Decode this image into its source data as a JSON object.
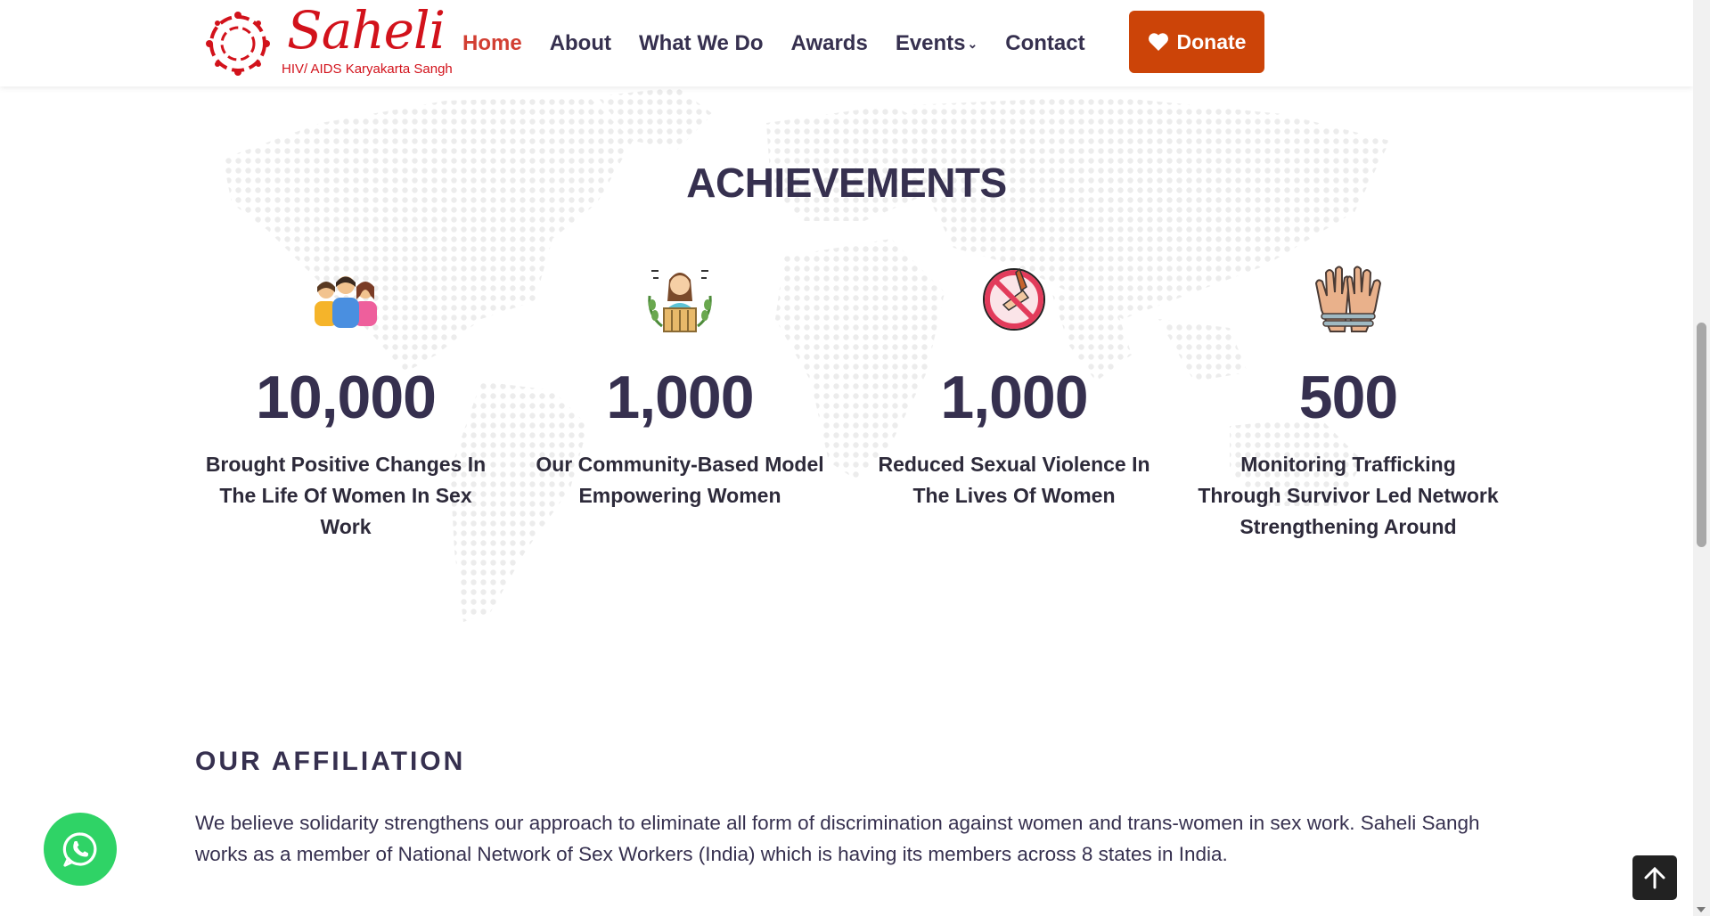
{
  "header": {
    "logo": {
      "name": "Saheli",
      "subtitle": "HIV/ AIDS Karyakarta Sangh"
    },
    "nav": [
      {
        "label": "Home",
        "active": true
      },
      {
        "label": "About",
        "active": false
      },
      {
        "label": "What We Do",
        "active": false
      },
      {
        "label": "Awards",
        "active": false
      },
      {
        "label": "Events",
        "active": false,
        "dropdown": true
      },
      {
        "label": "Contact",
        "active": false
      }
    ],
    "donate_label": "Donate"
  },
  "achievements": {
    "title": "ACHIEVEMENTS",
    "items": [
      {
        "icon": "women-group-icon",
        "value": "10,000",
        "text": "Brought Positive Changes In The Life Of Women In Sex Work"
      },
      {
        "icon": "woman-speaker-icon",
        "value": "1,000",
        "text": "Our Community-Based Model Empowering Women"
      },
      {
        "icon": "no-violence-icon",
        "value": "1,000",
        "text": "Reduced Sexual Violence In The Lives Of Women"
      },
      {
        "icon": "bound-hands-icon",
        "value": "500",
        "text": "Monitoring Trafficking Through Survivor Led Network Strengthening Around"
      }
    ]
  },
  "affiliation": {
    "title": "OUR AFFILIATION",
    "text": "We believe solidarity strengthens our approach to eliminate all form of discrimination against women and trans-women in sex work. Saheli Sangh works as a member of National Network of Sex Workers (India) which is having its members across 8 states in India."
  },
  "colors": {
    "brand": "#d2121b",
    "heading": "#36304f",
    "nav_active": "#d23f33",
    "donate": "#cc4408",
    "whatsapp": "#2fd366"
  }
}
